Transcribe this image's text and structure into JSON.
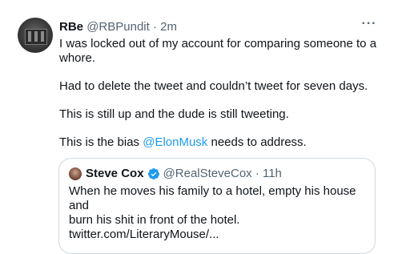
{
  "tweet": {
    "display_name": "RBe",
    "handle_time": "@RBPundit · 2m",
    "more_glyph": "···",
    "paragraphs": {
      "p1": "I was locked out of my account for comparing someone to a whore.",
      "p2": "Had to delete the tweet and couldn’t tweet for seven days.",
      "p3": "This is still up and the dude is still tweeting.",
      "p4_before": "This is the bias ",
      "p4_mention": "@ElonMusk",
      "p4_after": " needs to address."
    }
  },
  "quote": {
    "display_name": "Steve Cox",
    "verified_icon": "verified-badge-icon",
    "handle_time": "@RealSteveCox · 11h",
    "line1": "When he moves his family to a hotel, empty his house and",
    "line2": "burn his shit in front of the hotel.",
    "line3": "twitter.com/LiteraryMouse/..."
  },
  "colors": {
    "text": "#0f1419",
    "secondary": "#536471",
    "link": "#1d9bf0",
    "border": "#cfd9de"
  }
}
